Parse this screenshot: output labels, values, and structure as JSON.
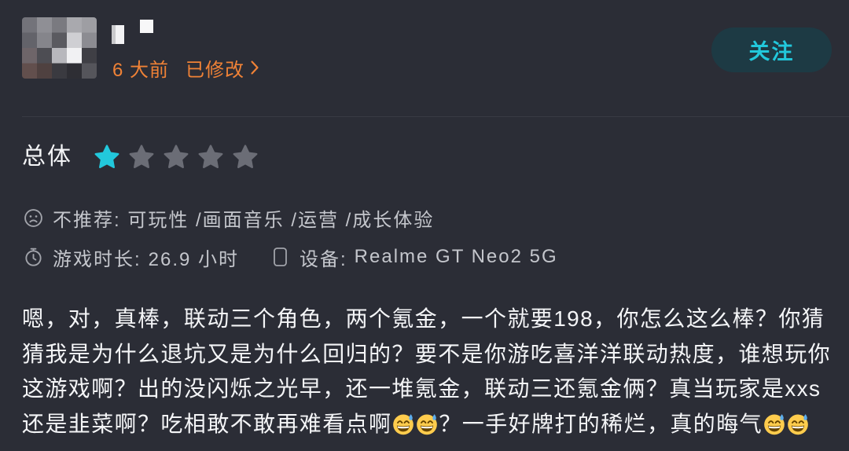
{
  "colors": {
    "background": "#2b2d36",
    "accent": "#22c8dc",
    "timestamp": "#f08236",
    "follow_button_bg": "#1d3a44",
    "star_empty": "#6b6d76",
    "text_primary": "#f4f5f7",
    "text_secondary": "#c4c6cc",
    "icon": "#a1a3aa",
    "divider": "#383a43"
  },
  "author": {
    "time_ago": "6 大前",
    "edited_label": "已修改",
    "edited_icon": "chevron-right-icon"
  },
  "follow_button": {
    "label": "关注"
  },
  "rating": {
    "label": "总体",
    "value": 1,
    "max": 5,
    "icon": "star-icon"
  },
  "meta": {
    "recommendation_icon": "sad-face-icon",
    "recommendation_text": "不推荐: 可玩性 /画面音乐 /运营 /成长体验",
    "playtime_icon": "stopwatch-icon",
    "playtime_label": "游戏时长:",
    "playtime_value": "26.9 小时",
    "device_icon": "phone-icon",
    "device_label": "设备:",
    "device_value": "Realme GT Neo2 5G"
  },
  "review": {
    "lines": [
      "嗯，对，真棒，联动三个角色，两个氪金，一个就要198，你怎么这么棒？你猜",
      "猜我是为什么退坑又是为什么回归的？要不是你游吃喜洋洋联动热度，谁想玩你",
      "这游戏啊？出的没闪烁之光早，还一堆氪金，联动三还氪金俩？真当玩家是xxs",
      "还是韭菜啊？吃相敢不敢再难看点啊😅😅？一手好牌打的稀烂，真的晦气😅😅"
    ]
  }
}
